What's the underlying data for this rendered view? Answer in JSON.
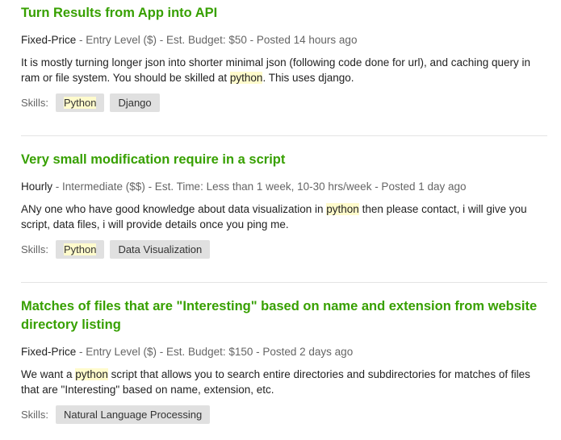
{
  "jobs": [
    {
      "title": "Turn Results from App into API",
      "kind": "Fixed-Price",
      "meta": " - Entry Level ($) - Est. Budget: $50 - Posted 14 hours ago",
      "desc": [
        {
          "t": "It is mostly turning longer json into shorter minimal json (following code done for url), and caching query in ram or file system. You should be skilled at ",
          "hl": false
        },
        {
          "t": "python",
          "hl": true
        },
        {
          "t": ". This uses django.",
          "hl": false
        }
      ],
      "skills_label": "Skills:",
      "skills": [
        "Python",
        "Django"
      ]
    },
    {
      "title": "Very small modification require in a script",
      "kind": "Hourly",
      "meta": " - Intermediate ($$) - Est. Time: Less than 1 week, 10-30 hrs/week - Posted 1 day ago",
      "desc": [
        {
          "t": "ANy one who have good knowledge about data visualization in ",
          "hl": false
        },
        {
          "t": "python",
          "hl": true
        },
        {
          "t": " then please contact, i will give you script, data files, i will provide details once you ping me.",
          "hl": false
        }
      ],
      "skills_label": "Skills:",
      "skills": [
        "Python",
        "Data Visualization"
      ]
    },
    {
      "title": "Matches of files that are \"Interesting\" based on name and extension from website directory listing",
      "kind": "Fixed-Price",
      "meta": " - Entry Level ($) - Est. Budget: $150 - Posted 2 days ago",
      "desc": [
        {
          "t": "We want a ",
          "hl": false
        },
        {
          "t": "python",
          "hl": true
        },
        {
          "t": " script that allows you to search entire directories and subdirectories for matches of files that are \"Interesting\" based on name, extension, etc.",
          "hl": false
        }
      ],
      "skills_label": "Skills:",
      "skills": [
        "Natural Language Processing"
      ]
    }
  ],
  "highlight_term": "python",
  "colors": {
    "title": "#37a000",
    "highlight": "#fffbcc",
    "skill_bg": "#e0e0e0"
  }
}
